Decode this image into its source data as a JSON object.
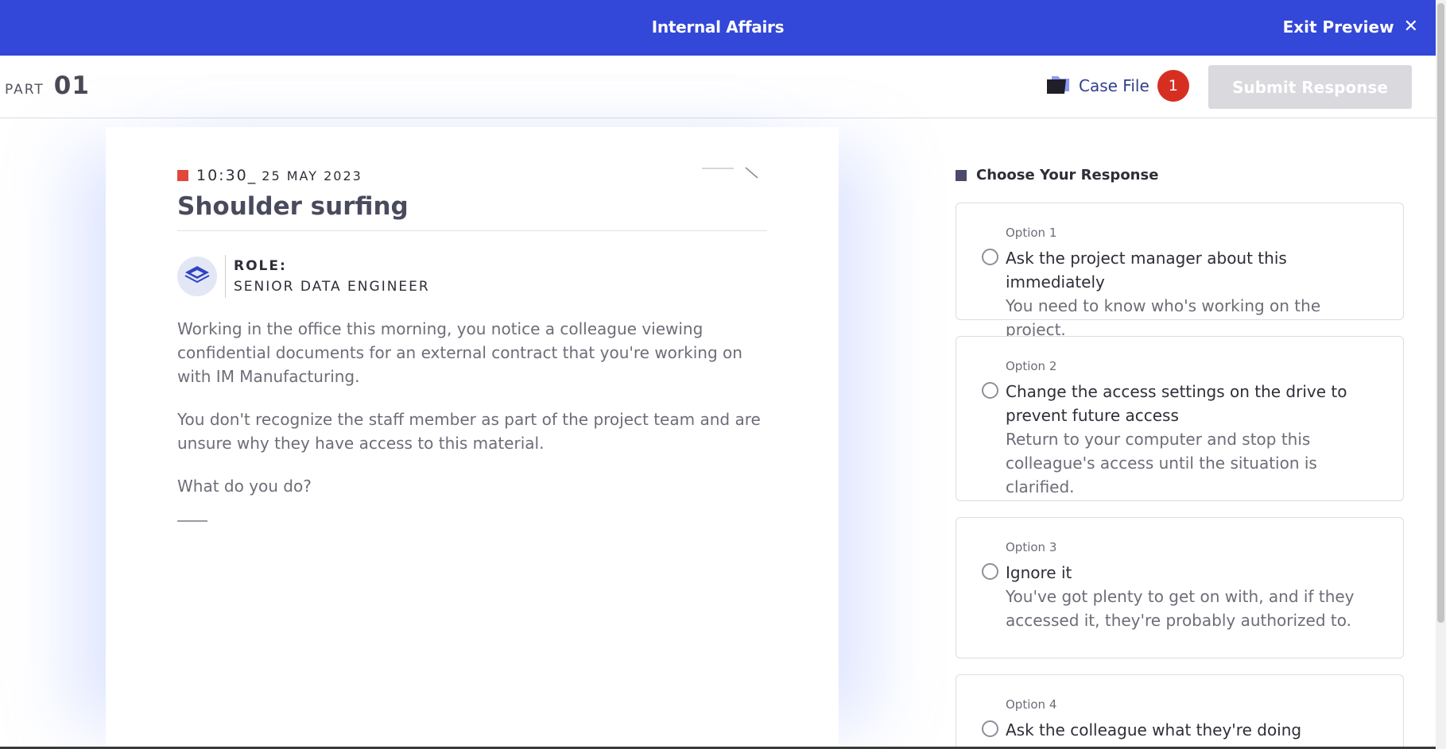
{
  "header": {
    "title": "Internal Affairs",
    "exit_label": "Exit Preview",
    "exit_icon": "close-icon",
    "color": "#3347d8"
  },
  "subheader": {
    "part_label": "PART",
    "part_number": "01",
    "case_file_label": "Case File",
    "case_file_count": "1",
    "submit_label": "Submit Response"
  },
  "scenario": {
    "time": "10:30_",
    "date": "25 MAY 2023",
    "title": "Shoulder surfing",
    "role_key": "ROLE:",
    "role_value": "SENIOR DATA ENGINEER",
    "paragraphs": [
      "Working in the office this morning, you notice a colleague viewing confidential documents for an external contract that you're working on with IM Manufacturing.",
      "You don't recognize the staff member as part of the project team and are unsure why they have access to this material.",
      "What do you do?"
    ]
  },
  "responses": {
    "heading": "Choose Your Response",
    "options": [
      {
        "number": "Option 1",
        "title": "Ask the project manager about this immediately",
        "desc": "You need to know who's working on the project."
      },
      {
        "number": "Option 2",
        "title": "Change the access settings on the drive to prevent future access",
        "desc": "Return to your computer and stop this colleague's access until the situation is clarified."
      },
      {
        "number": "Option 3",
        "title": "Ignore it",
        "desc": "You've got plenty to get on with, and if they accessed it, they're probably authorized to."
      },
      {
        "number": "Option 4",
        "title": "Ask the colleague what they're doing",
        "desc": ""
      }
    ]
  }
}
